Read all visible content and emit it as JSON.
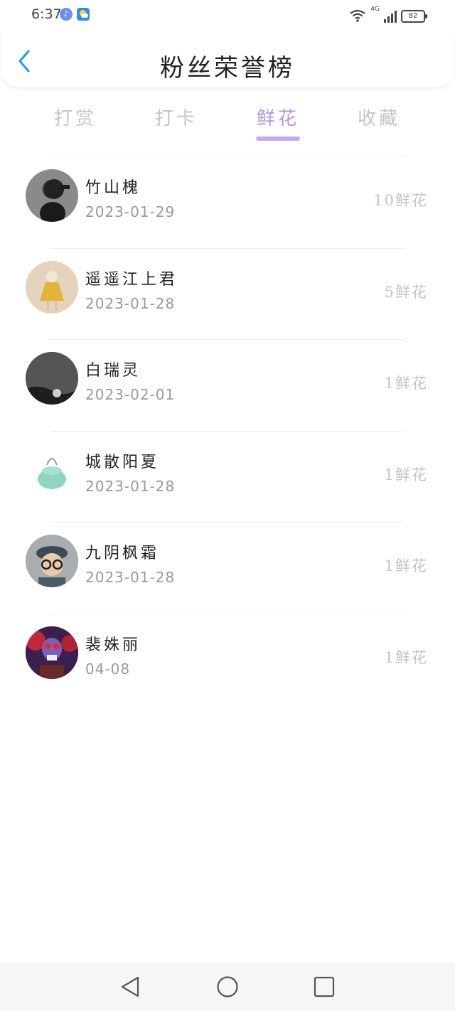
{
  "status_bar": {
    "time": "6:37",
    "network": "4G",
    "battery": "82",
    "icons": [
      "music-icon",
      "weather-icon",
      "wifi-icon",
      "signal-icon",
      "battery-icon"
    ]
  },
  "header": {
    "title": "粉丝荣誉榜",
    "back_icon": "chevron-left-icon"
  },
  "tabs": [
    {
      "label": "打赏",
      "active": false
    },
    {
      "label": "打卡",
      "active": false
    },
    {
      "label": "鲜花",
      "active": true
    },
    {
      "label": "收藏",
      "active": false
    }
  ],
  "fans": [
    {
      "name": "竹山槐",
      "date": "2023-01-29",
      "amount": "10鲜花"
    },
    {
      "name": "遥遥江上君",
      "date": "2023-01-28",
      "amount": "5鲜花"
    },
    {
      "name": "白瑞灵",
      "date": "2023-02-01",
      "amount": "1鲜花"
    },
    {
      "name": "城散阳夏",
      "date": "2023-01-28",
      "amount": "1鲜花"
    },
    {
      "name": "九阴枫霜",
      "date": "2023-01-28",
      "amount": "1鲜花"
    },
    {
      "name": "裴姝丽",
      "date": "04-08",
      "amount": "1鲜花"
    }
  ],
  "colors": {
    "accent": "#b596e0",
    "indicator": "#c8a8ec",
    "back_arrow": "#2e9be6",
    "muted_text": "#c4c4c4"
  },
  "nav_bar": [
    "back-triangle-icon",
    "home-circle-icon",
    "recents-square-icon"
  ]
}
